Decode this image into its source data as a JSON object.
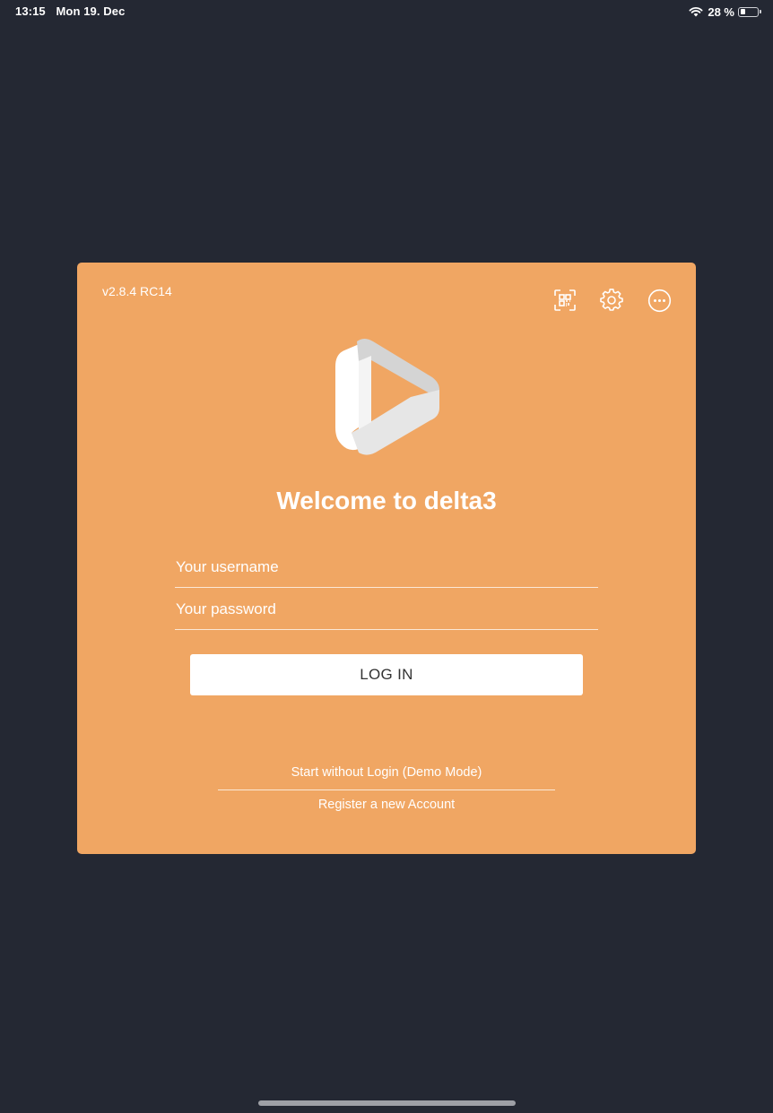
{
  "status_bar": {
    "time": "13:15",
    "date": "Mon 19. Dec",
    "battery": "28 %",
    "battery_level": 0.28
  },
  "card": {
    "version": "v2.8.4 RC14",
    "toolbar_icons": [
      "qr-code-scan-icon",
      "gear-icon",
      "more-options-icon"
    ],
    "welcome_title": "Welcome to delta3",
    "username_placeholder": "Your username",
    "password_placeholder": "Your password",
    "login_label": "LOG IN",
    "demo_link": "Start without Login (Demo Mode)",
    "register_link": "Register a new Account"
  },
  "colors": {
    "background": "#242833",
    "card": "#f0a663",
    "button": "#ffffff"
  }
}
